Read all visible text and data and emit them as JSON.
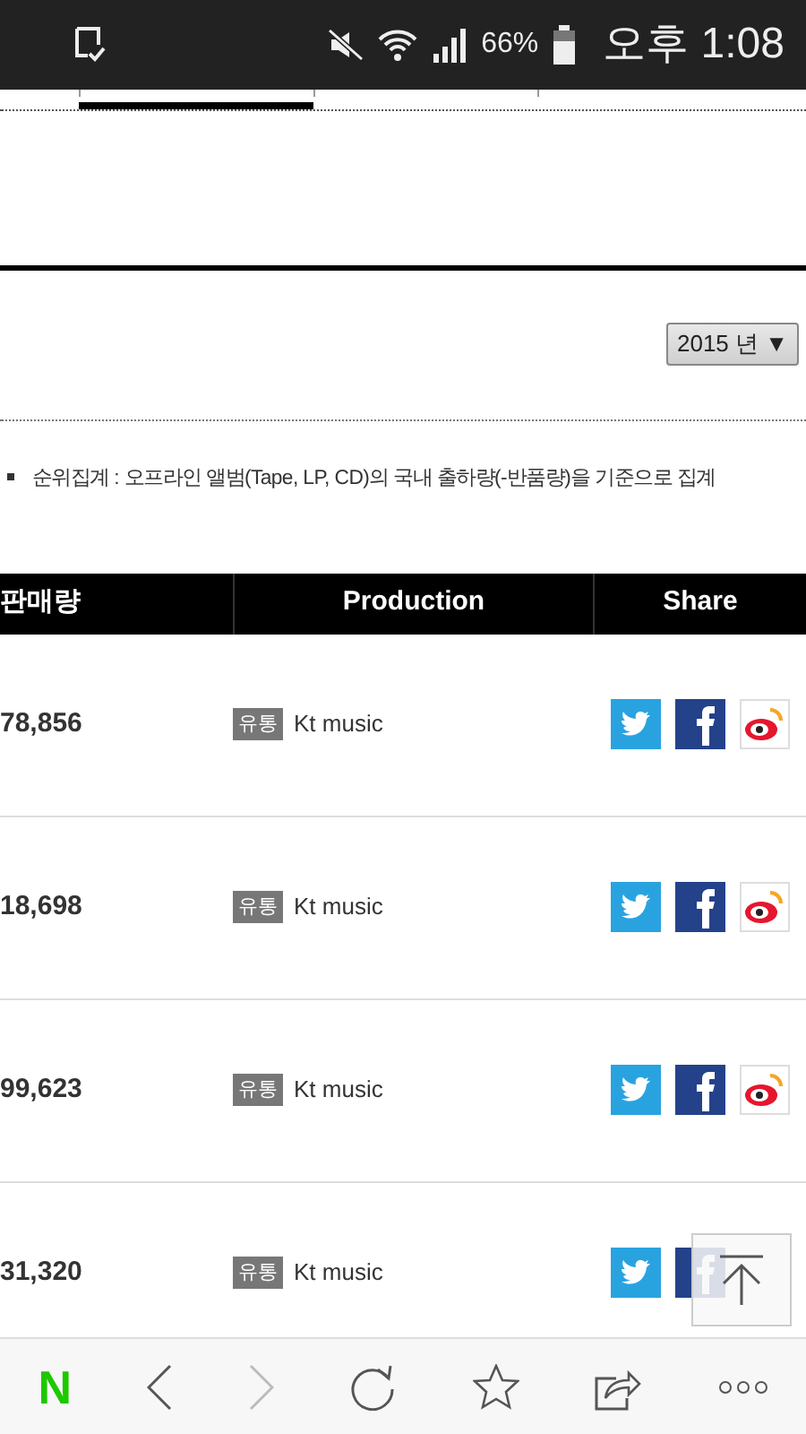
{
  "status_bar": {
    "battery": "66%",
    "time": "오후 1:08"
  },
  "year_select": {
    "value": "2015 년",
    "caret": "▼"
  },
  "note": "순위집계 : 오프라인 앨범(Tape, LP, CD)의 국내 출하량(-반품량)을 기준으로 집계",
  "table": {
    "columns": [
      "판매량",
      "Production",
      "Share"
    ],
    "rows": [
      {
        "sales": "78,856",
        "tag": "유통",
        "production": "Kt music"
      },
      {
        "sales": "18,698",
        "tag": "유통",
        "production": "Kt music"
      },
      {
        "sales": "99,623",
        "tag": "유통",
        "production": "Kt music"
      },
      {
        "sales": "31,320",
        "tag": "유통",
        "production": "Kt music"
      }
    ]
  },
  "toolbar": {
    "logo": "N",
    "forward_disabled": true
  }
}
